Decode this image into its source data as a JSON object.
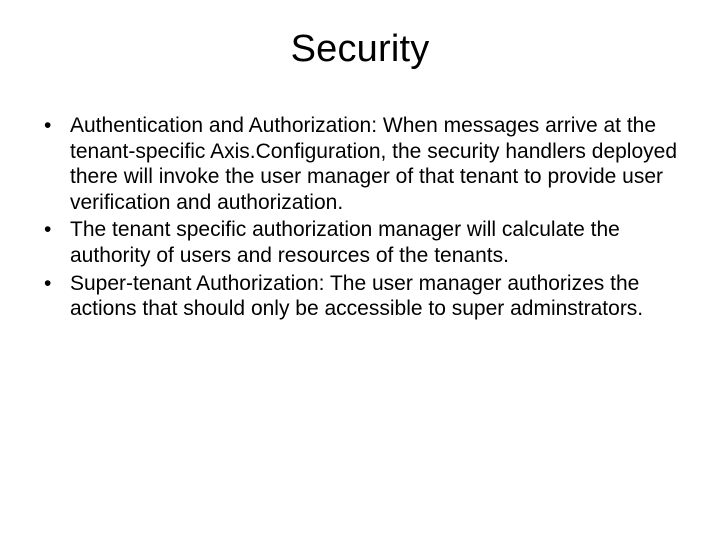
{
  "title": "Security",
  "bullets": [
    "Authentication and Authorization: When messages arrive at the tenant-specific Axis.Configuration, the security handlers deployed there will invoke the user manager of that tenant to provide user verification and authorization.",
    "The tenant specific authorization manager will calculate the authority of users and resources of the tenants.",
    "Super-tenant Authorization: The user manager authorizes the actions that should only be accessible to super adminstrators."
  ]
}
